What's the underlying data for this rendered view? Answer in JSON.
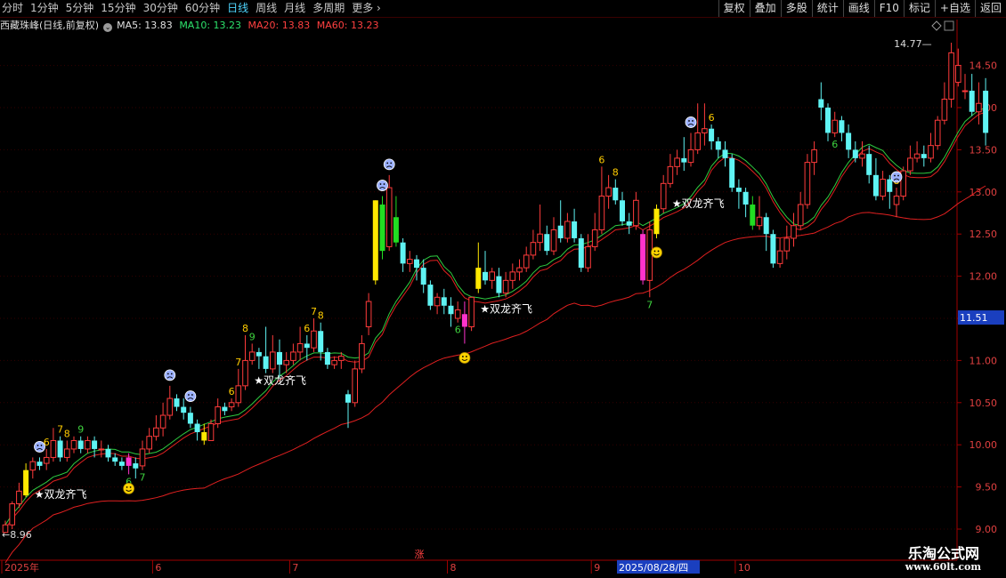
{
  "toolbar": {
    "periods": [
      "分时",
      "1分钟",
      "5分钟",
      "15分钟",
      "30分钟",
      "60分钟",
      "日线",
      "周线",
      "月线",
      "多周期",
      "更多"
    ],
    "active_period": "日线",
    "tools": [
      "复权",
      "叠加",
      "多股",
      "统计",
      "画线",
      "F10",
      "标记",
      "+自选",
      "返回"
    ]
  },
  "info": {
    "title": "西藏珠峰(日线,前复权)",
    "ma5_label": "MA5: 13.83",
    "ma10_label": "MA10: 13.23",
    "ma20_label": "MA20: 13.83",
    "ma60_label": "MA60: 13.23"
  },
  "colors": {
    "up": "#ff3b3b",
    "down": "#5ff3f3",
    "ma_green": "#2ecc40",
    "ma_red": "#e02020",
    "yellow": "#ffe800",
    "magenta": "#ff33cc",
    "green_bar": "#22dd22",
    "axis": "#a00000",
    "label": "#e04040"
  },
  "chart_data": {
    "type": "candlestick",
    "ylim": [
      9.0,
      14.7
    ],
    "y_ticks": [
      "14.50",
      "14.00",
      "13.50",
      "13.00",
      "12.50",
      "12.00",
      "11.50",
      "11.00",
      "10.50",
      "10.00",
      "9.50",
      "9.00"
    ],
    "x_labels": [
      "2025年",
      "6",
      "7",
      "8",
      "9",
      "10"
    ],
    "x_label_index": [
      0,
      22,
      42,
      65,
      86,
      107
    ],
    "cursor_date": "2025/08/28/四",
    "cursor_price": "11.51",
    "high_label": "14.77",
    "low_label": "8.96",
    "center_label": "涨",
    "candles": [
      [
        8.96,
        9.05,
        8.95,
        9.1
      ],
      [
        9.05,
        9.3,
        9.0,
        9.33
      ],
      [
        9.3,
        9.45,
        9.25,
        9.55
      ],
      [
        9.4,
        9.7,
        9.38,
        9.78
      ],
      [
        9.7,
        9.8,
        9.6,
        9.85
      ],
      [
        9.8,
        9.75,
        9.7,
        9.85
      ],
      [
        9.78,
        9.85,
        9.7,
        9.95
      ],
      [
        9.85,
        10.05,
        9.8,
        10.2
      ],
      [
        10.05,
        9.85,
        9.8,
        10.1
      ],
      [
        9.85,
        9.95,
        9.8,
        10.05
      ],
      [
        9.95,
        10.05,
        9.9,
        10.1
      ],
      [
        10.05,
        9.95,
        9.9,
        10.1
      ],
      [
        9.95,
        10.05,
        9.9,
        10.1
      ],
      [
        10.05,
        9.95,
        9.85,
        10.1
      ],
      [
        9.95,
        9.95,
        9.85,
        10.05
      ],
      [
        9.95,
        9.85,
        9.8,
        10.0
      ],
      [
        9.85,
        9.8,
        9.75,
        9.9
      ],
      [
        9.8,
        9.75,
        9.7,
        9.85
      ],
      [
        9.75,
        9.85,
        9.65,
        9.9
      ],
      [
        9.78,
        9.72,
        9.6,
        9.85
      ],
      [
        9.75,
        9.95,
        9.7,
        10.05
      ],
      [
        9.95,
        10.1,
        9.9,
        10.2
      ],
      [
        10.1,
        10.2,
        10.05,
        10.35
      ],
      [
        10.2,
        10.35,
        10.1,
        10.5
      ],
      [
        10.35,
        10.55,
        10.3,
        10.7
      ],
      [
        10.55,
        10.45,
        10.4,
        10.6
      ],
      [
        10.45,
        10.38,
        10.3,
        10.55
      ],
      [
        10.38,
        10.25,
        10.2,
        10.45
      ],
      [
        10.25,
        10.15,
        10.05,
        10.3
      ],
      [
        10.15,
        10.05,
        10.0,
        10.25
      ],
      [
        10.05,
        10.25,
        10.05,
        10.3
      ],
      [
        10.25,
        10.45,
        10.2,
        10.55
      ],
      [
        10.45,
        10.4,
        10.35,
        10.5
      ],
      [
        10.45,
        10.5,
        10.4,
        10.55
      ],
      [
        10.5,
        10.7,
        10.45,
        10.9
      ],
      [
        10.7,
        11.0,
        10.65,
        11.3
      ],
      [
        11.0,
        11.1,
        10.95,
        11.2
      ],
      [
        11.1,
        11.05,
        10.9,
        11.15
      ],
      [
        11.05,
        10.9,
        10.85,
        11.4
      ],
      [
        10.9,
        11.1,
        10.85,
        11.3
      ],
      [
        11.1,
        10.95,
        10.8,
        11.25
      ],
      [
        10.95,
        11.0,
        10.85,
        11.1
      ],
      [
        11.0,
        11.1,
        10.95,
        11.2
      ],
      [
        11.1,
        11.2,
        11.0,
        11.4
      ],
      [
        11.2,
        11.15,
        11.0,
        11.3
      ],
      [
        11.15,
        11.35,
        11.1,
        11.5
      ],
      [
        11.35,
        11.1,
        11.0,
        11.45
      ],
      [
        11.1,
        10.95,
        10.9,
        11.15
      ],
      [
        10.95,
        11.0,
        10.9,
        11.05
      ],
      [
        11.0,
        11.05,
        10.9,
        11.1
      ],
      [
        10.6,
        10.5,
        10.2,
        10.65
      ],
      [
        10.5,
        10.9,
        10.45,
        11.0
      ],
      [
        10.9,
        11.2,
        10.85,
        11.3
      ],
      [
        11.4,
        11.7,
        11.3,
        11.8
      ],
      [
        11.95,
        12.9,
        11.9,
        12.9
      ],
      [
        12.85,
        12.3,
        12.2,
        12.95
      ],
      [
        12.35,
        13.05,
        12.3,
        13.2
      ],
      [
        12.7,
        12.4,
        12.35,
        12.95
      ],
      [
        12.4,
        12.15,
        12.05,
        12.45
      ],
      [
        12.15,
        12.2,
        12.05,
        12.3
      ],
      [
        12.2,
        12.1,
        11.95,
        12.25
      ],
      [
        12.1,
        11.9,
        11.8,
        12.2
      ],
      [
        11.9,
        11.65,
        11.6,
        11.95
      ],
      [
        11.65,
        11.75,
        11.55,
        11.8
      ],
      [
        11.75,
        11.65,
        11.55,
        11.85
      ],
      [
        11.65,
        11.55,
        11.4,
        11.75
      ],
      [
        11.5,
        11.6,
        11.45,
        11.7
      ],
      [
        11.55,
        11.4,
        11.2,
        11.7
      ],
      [
        11.4,
        11.75,
        11.35,
        11.75
      ],
      [
        11.85,
        12.1,
        11.8,
        12.4
      ],
      [
        12.05,
        11.95,
        11.9,
        12.3
      ],
      [
        11.95,
        12.05,
        11.85,
        12.1
      ],
      [
        12.0,
        11.8,
        11.75,
        12.1
      ],
      [
        11.8,
        11.95,
        11.75,
        12.05
      ],
      [
        11.95,
        12.05,
        11.85,
        12.15
      ],
      [
        12.05,
        12.1,
        11.95,
        12.2
      ],
      [
        12.1,
        12.25,
        12.05,
        12.35
      ],
      [
        12.25,
        12.4,
        12.2,
        12.55
      ],
      [
        12.4,
        12.5,
        12.3,
        12.85
      ],
      [
        12.5,
        12.3,
        12.25,
        12.6
      ],
      [
        12.3,
        12.55,
        12.25,
        12.7
      ],
      [
        12.6,
        12.45,
        12.4,
        12.9
      ],
      [
        12.45,
        12.65,
        12.4,
        12.75
      ],
      [
        12.65,
        12.45,
        12.4,
        12.8
      ],
      [
        12.45,
        12.1,
        12.05,
        12.5
      ],
      [
        12.1,
        12.35,
        12.05,
        12.5
      ],
      [
        12.35,
        12.55,
        12.3,
        12.75
      ],
      [
        12.55,
        12.95,
        12.5,
        13.3
      ],
      [
        12.95,
        13.05,
        12.8,
        13.2
      ],
      [
        13.05,
        12.9,
        12.85,
        13.15
      ],
      [
        12.9,
        12.65,
        12.6,
        13.0
      ],
      [
        12.65,
        12.6,
        12.5,
        12.75
      ],
      [
        12.6,
        12.9,
        12.55,
        13.0
      ],
      [
        12.5,
        11.95,
        11.9,
        12.55
      ],
      [
        11.95,
        12.55,
        11.75,
        12.65
      ],
      [
        12.5,
        12.8,
        12.45,
        12.85
      ],
      [
        12.8,
        13.1,
        12.75,
        13.2
      ],
      [
        13.1,
        13.3,
        13.05,
        13.45
      ],
      [
        13.3,
        13.4,
        13.2,
        13.5
      ],
      [
        13.4,
        13.35,
        13.25,
        13.65
      ],
      [
        13.35,
        13.5,
        13.3,
        13.7
      ],
      [
        13.5,
        13.7,
        13.45,
        14.05
      ],
      [
        13.7,
        13.75,
        13.55,
        14.05
      ],
      [
        13.75,
        13.6,
        13.5,
        13.8
      ],
      [
        13.6,
        13.5,
        13.4,
        13.65
      ],
      [
        13.5,
        13.4,
        13.3,
        13.6
      ],
      [
        13.4,
        13.05,
        13.0,
        13.45
      ],
      [
        13.05,
        13.0,
        12.8,
        13.15
      ],
      [
        13.0,
        12.85,
        12.7,
        13.05
      ],
      [
        12.85,
        12.6,
        12.55,
        12.95
      ],
      [
        12.6,
        12.7,
        12.55,
        12.95
      ],
      [
        12.7,
        12.5,
        12.3,
        12.75
      ],
      [
        12.5,
        12.15,
        12.1,
        12.55
      ],
      [
        12.15,
        12.3,
        12.1,
        12.45
      ],
      [
        12.3,
        12.45,
        12.2,
        12.6
      ],
      [
        12.45,
        12.6,
        12.35,
        12.75
      ],
      [
        12.6,
        12.85,
        12.55,
        13.0
      ],
      [
        12.85,
        13.35,
        12.8,
        13.45
      ],
      [
        13.35,
        13.5,
        13.2,
        13.6
      ],
      [
        14.1,
        14.0,
        13.85,
        14.3
      ],
      [
        14.0,
        13.7,
        13.6,
        14.05
      ],
      [
        13.7,
        13.85,
        13.65,
        13.95
      ],
      [
        13.85,
        13.7,
        13.6,
        13.9
      ],
      [
        13.7,
        13.5,
        13.4,
        13.8
      ],
      [
        13.5,
        13.4,
        13.35,
        13.6
      ],
      [
        13.4,
        13.45,
        13.3,
        13.6
      ],
      [
        13.45,
        13.2,
        13.1,
        13.55
      ],
      [
        13.2,
        12.95,
        12.9,
        13.4
      ],
      [
        12.95,
        13.15,
        12.9,
        13.25
      ],
      [
        13.15,
        13.0,
        12.8,
        13.2
      ],
      [
        12.85,
        12.95,
        12.7,
        13.05
      ],
      [
        12.95,
        13.25,
        12.9,
        13.3
      ],
      [
        13.25,
        13.4,
        13.2,
        13.55
      ],
      [
        13.4,
        13.45,
        13.35,
        13.6
      ],
      [
        13.45,
        13.4,
        13.3,
        13.55
      ],
      [
        13.4,
        13.55,
        13.35,
        13.7
      ],
      [
        13.55,
        13.85,
        13.5,
        13.9
      ],
      [
        13.85,
        14.1,
        13.8,
        14.3
      ],
      [
        14.1,
        14.65,
        14.0,
        14.77
      ],
      [
        14.3,
        14.5,
        14.25,
        14.7
      ],
      [
        14.2,
        14.2,
        14.1,
        14.4
      ],
      [
        14.2,
        13.95,
        13.9,
        14.4
      ],
      [
        13.95,
        14.05,
        13.8,
        14.3
      ],
      [
        14.2,
        13.7,
        13.55,
        14.35
      ]
    ],
    "highlight": [
      [
        3,
        "yellow"
      ],
      [
        18,
        "magenta"
      ],
      [
        29,
        "yellow"
      ],
      [
        54,
        "yellow"
      ],
      [
        55,
        "green_bar"
      ],
      [
        57,
        "green_bar"
      ],
      [
        67,
        "magenta"
      ],
      [
        69,
        "yellow"
      ],
      [
        93,
        "magenta"
      ],
      [
        95,
        "yellow"
      ],
      [
        109,
        "green_bar"
      ]
    ],
    "markers": [
      {
        "i": 6,
        "t": "6",
        "c": "#ffcc00",
        "p": "above"
      },
      {
        "i": 8,
        "t": "7",
        "c": "#ffcc00",
        "p": "above"
      },
      {
        "i": 9,
        "t": "8",
        "c": "#ffcc00",
        "p": "above"
      },
      {
        "i": 11,
        "t": "9",
        "c": "#3ed23e",
        "p": "above"
      },
      {
        "i": 18,
        "t": "6",
        "c": "#3ed23e",
        "p": "below"
      },
      {
        "i": 20,
        "t": "7",
        "c": "#3ed23e",
        "p": "below"
      },
      {
        "i": 33,
        "t": "6",
        "c": "#ffcc00",
        "p": "above"
      },
      {
        "i": 34,
        "t": "7",
        "c": "#ffcc00",
        "p": "above"
      },
      {
        "i": 35,
        "t": "8",
        "c": "#ffcc00",
        "p": "above"
      },
      {
        "i": 36,
        "t": "9",
        "c": "#3ed23e",
        "p": "above"
      },
      {
        "i": 44,
        "t": "6",
        "c": "#ffcc00",
        "p": "above"
      },
      {
        "i": 45,
        "t": "7",
        "c": "#ffcc00",
        "p": "above"
      },
      {
        "i": 46,
        "t": "8",
        "c": "#ffcc00",
        "p": "above"
      },
      {
        "i": 66,
        "t": "6",
        "c": "#3ed23e",
        "p": "below"
      },
      {
        "i": 87,
        "t": "6",
        "c": "#ffcc00",
        "p": "above"
      },
      {
        "i": 89,
        "t": "8",
        "c": "#ffcc00",
        "p": "above"
      },
      {
        "i": 94,
        "t": "7",
        "c": "#3ed23e",
        "p": "below"
      },
      {
        "i": 103,
        "t": "6",
        "c": "#ffcc00",
        "p": "above"
      },
      {
        "i": 121,
        "t": "6",
        "c": "#3ed23e",
        "p": "below"
      },
      {
        "i": 130,
        "t": "8",
        "c": "#ffcc00",
        "p": "above"
      }
    ],
    "sad_faces": [
      5,
      24,
      27,
      55,
      56,
      100,
      130
    ],
    "happy_faces": [
      18,
      67,
      95
    ],
    "dragon_signals": [
      {
        "i": 4,
        "label": "★双龙齐飞"
      },
      {
        "i": 36,
        "label": "★双龙齐飞"
      },
      {
        "i": 69,
        "label": "★双龙齐飞"
      },
      {
        "i": 97,
        "label": "★双龙齐飞"
      }
    ]
  },
  "watermark": {
    "line1": "乐淘公式网",
    "line2": "www.60lt.com"
  }
}
